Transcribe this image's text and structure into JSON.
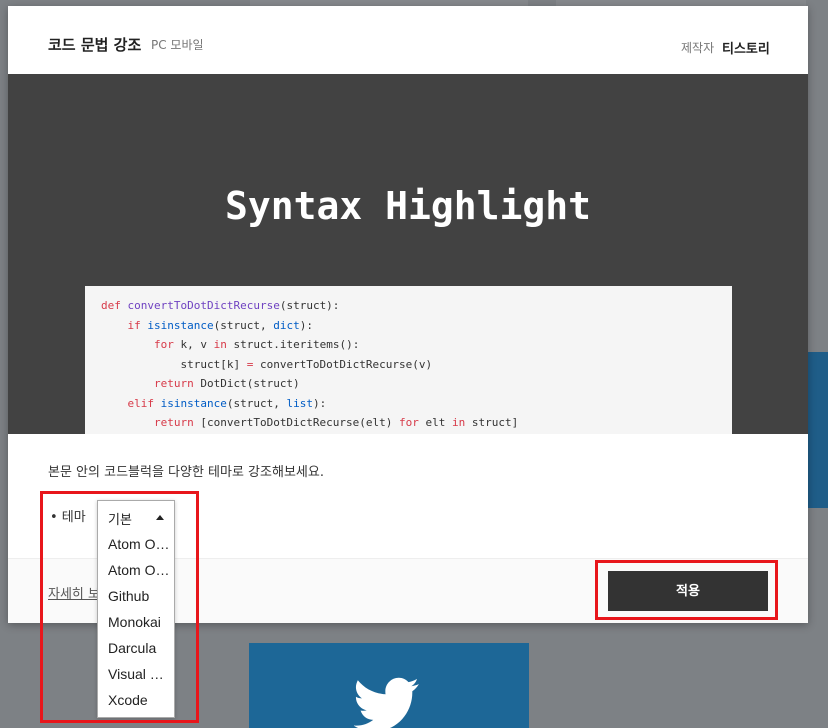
{
  "modal": {
    "title": "코드 문법 강조",
    "subtitle": "PC 모바일",
    "maker_label": "제작자",
    "maker_name": "티스토리",
    "preview_title": "Syntax Highlight",
    "code_lines": [
      [
        {
          "t": "def ",
          "c": "kw"
        },
        {
          "t": "convertToDotDictRecurse",
          "c": "fn"
        },
        {
          "t": "(struct):",
          "c": ""
        }
      ],
      [
        {
          "t": "    ",
          "c": ""
        },
        {
          "t": "if ",
          "c": "kw"
        },
        {
          "t": "isinstance",
          "c": "bi"
        },
        {
          "t": "(struct, ",
          "c": ""
        },
        {
          "t": "dict",
          "c": "bi"
        },
        {
          "t": "):",
          "c": ""
        }
      ],
      [
        {
          "t": "        ",
          "c": ""
        },
        {
          "t": "for ",
          "c": "kw"
        },
        {
          "t": "k, v ",
          "c": ""
        },
        {
          "t": "in ",
          "c": "kw"
        },
        {
          "t": "struct.iteritems():",
          "c": ""
        }
      ],
      [
        {
          "t": "            struct[k] ",
          "c": ""
        },
        {
          "t": "= ",
          "c": "kw"
        },
        {
          "t": "convertToDotDictRecurse(v)",
          "c": ""
        }
      ],
      [
        {
          "t": "        ",
          "c": ""
        },
        {
          "t": "return ",
          "c": "kw"
        },
        {
          "t": "DotDict(struct)",
          "c": ""
        }
      ],
      [
        {
          "t": "    ",
          "c": ""
        },
        {
          "t": "elif ",
          "c": "kw"
        },
        {
          "t": "isinstance",
          "c": "bi"
        },
        {
          "t": "(struct, ",
          "c": ""
        },
        {
          "t": "list",
          "c": "bi"
        },
        {
          "t": "):",
          "c": ""
        }
      ],
      [
        {
          "t": "        ",
          "c": ""
        },
        {
          "t": "return ",
          "c": "kw"
        },
        {
          "t": "[convertToDotDictRecurse(elt) ",
          "c": ""
        },
        {
          "t": "for ",
          "c": "kw"
        },
        {
          "t": "elt ",
          "c": ""
        },
        {
          "t": "in ",
          "c": "kw"
        },
        {
          "t": "struct]",
          "c": ""
        }
      ]
    ],
    "description": "본문 안의 코드블럭을 다양한 테마로 강조해보세요.",
    "theme_label": "• 테마",
    "more_link": "자세히 보",
    "apply_label": "적용"
  },
  "dropdown": {
    "selected": "기본",
    "options": [
      "Atom O…",
      "Atom O…",
      "Github",
      "Monokai",
      "Darcula",
      "Visual S…",
      "Xcode"
    ]
  },
  "colors": {
    "annotation": "#e8161b",
    "preview_bg": "#424242",
    "apply_bg": "#333333"
  }
}
